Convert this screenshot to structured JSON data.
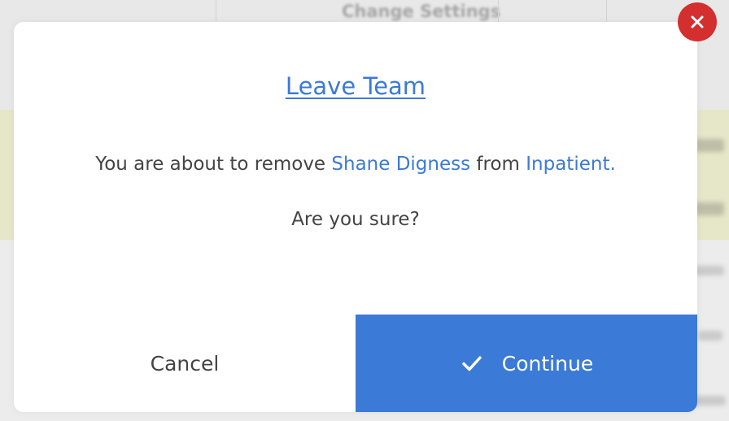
{
  "background": {
    "header_title": "Change Settings"
  },
  "modal": {
    "title": "Leave Team",
    "message": {
      "prefix": "You are about to remove ",
      "member": "Shane Digness",
      "middle": " from ",
      "team": "Inpatient."
    },
    "question": "Are you sure?",
    "buttons": {
      "cancel_label": "Cancel",
      "continue_label": "Continue"
    }
  },
  "icons": {
    "close": "close-icon",
    "confirm": "checkmark-icon"
  },
  "colors": {
    "accent": "#3b7ad7",
    "close_button": "#d32f2f",
    "text": "#444444",
    "banner": "#e6e6c8"
  }
}
